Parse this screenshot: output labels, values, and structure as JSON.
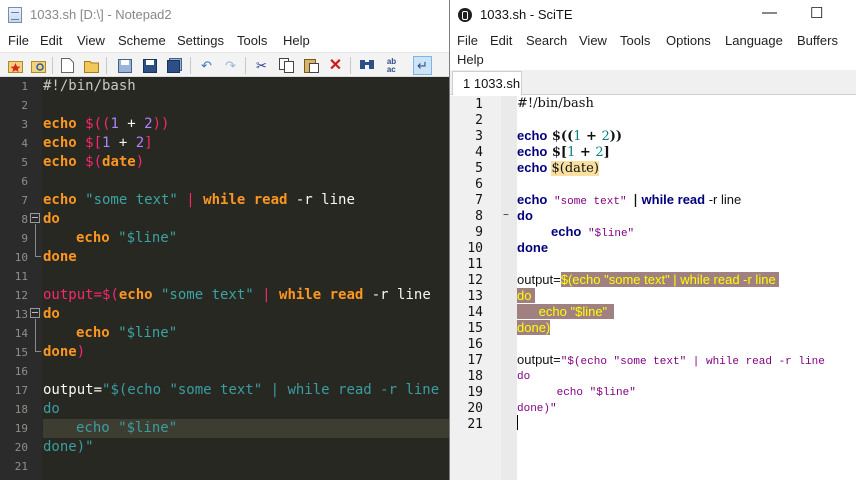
{
  "notepad2": {
    "title": "1033.sh [D:\\] - Notepad2",
    "menu": [
      "File",
      "Edit",
      "View",
      "Scheme",
      "Settings",
      "Tools",
      "Help"
    ],
    "line_numbers": [
      "1",
      "2",
      "3",
      "4",
      "5",
      "6",
      "7",
      "8",
      "9",
      "10",
      "11",
      "12",
      "13",
      "14",
      "15",
      "16",
      "17",
      "18",
      "19",
      "20",
      "21"
    ],
    "lines": {
      "l1": "#!/bin/bash",
      "l3": {
        "kw": "echo",
        "rest_a": " $((",
        "num1": "1",
        "op": " + ",
        "num2": "2",
        "rest_b": "))"
      },
      "l4": {
        "kw": "echo",
        "rest_a": " $[",
        "num1": "1",
        "op": " + ",
        "num2": "2",
        "rest_b": "]"
      },
      "l5": {
        "kw": "echo",
        "rest_a": " $(",
        "cmd": "date",
        "rest_b": ")"
      },
      "l7": {
        "kw": "echo",
        "str": " \"some text\" ",
        "pipe": "|",
        "kw2": " while read",
        "rest": " -r line"
      },
      "l8": "do",
      "l9": {
        "kw": "echo",
        "str": " \"$line\""
      },
      "l10": "done",
      "l12": {
        "pre": "output=$(",
        "kw": "echo",
        "str": " \"some text\" ",
        "pipe": "|",
        "kw2": " while read",
        "rest": " -r line"
      },
      "l13": "do",
      "l14": {
        "kw": "echo",
        "str": " \"$line\""
      },
      "l15": {
        "kw": "done",
        "rest": ")"
      },
      "l17": {
        "pre": "output=",
        "str": "\"$(echo \"some text\" | while read -r line"
      },
      "l18": "do",
      "l19": "echo \"$line\"",
      "l20": "done)\""
    }
  },
  "scite": {
    "title": "1033.sh - SciTE",
    "minimize": "—",
    "maximize": "☐",
    "menu_row1": [
      "File",
      "Edit",
      "Search",
      "View",
      "Tools",
      "Options",
      "Language",
      "Buffers"
    ],
    "menu_row2": [
      "Help"
    ],
    "tab_label": "1 1033.sh",
    "line_numbers": [
      "1",
      "2",
      "3",
      "4",
      "5",
      "6",
      "7",
      "8",
      "9",
      "10",
      "11",
      "12",
      "13",
      "14",
      "15",
      "16",
      "17",
      "18",
      "19",
      "20",
      "21"
    ],
    "lines": {
      "l1": "#!/bin/bash",
      "l3": {
        "kw": "echo",
        "pre": " $((",
        "num1": "1",
        "op": " + ",
        "num2": "2",
        "post": "))"
      },
      "l4": {
        "kw": "echo",
        "pre": " $[",
        "num1": "1",
        "op": " + ",
        "num2": "2",
        "post": "]"
      },
      "l5": {
        "kw": "echo",
        "sub": "$(date)"
      },
      "l7": {
        "kw": "echo",
        "str": " \"some text\" ",
        "pipe": "|",
        "kw2": " while read",
        "rest": " -r line"
      },
      "l8": "do",
      "l9": {
        "kw": "echo",
        "str": " \"$line\""
      },
      "l10": "done",
      "l12": {
        "pre": "output=",
        "bt": "$(echo \"some text\" | while read -r line "
      },
      "l13": "do ",
      "l14": "      echo \"$line\"  ",
      "l15": "done)",
      "l17": {
        "pre": "output=",
        "str": "\"$(echo \"some text\" | while read -r line"
      },
      "l18": "do",
      "l19": "      echo \"$line\"",
      "l20": "done)\""
    }
  },
  "colors": {
    "notepad2_bg": "#272822",
    "notepad2_keyword": "#fd971f",
    "notepad2_string": "#3ba3a3",
    "notepad2_number": "#ae81ff",
    "scite_keyword": "#00007f",
    "scite_string": "#7f007f",
    "scite_backtick_bg": "#a08080"
  },
  "icons": [
    "new-icon",
    "open-icon",
    "browse-icon",
    "save-icon",
    "save-as-icon",
    "save-copy-icon",
    "undo-icon",
    "redo-icon",
    "cut-icon",
    "copy-icon",
    "paste-icon",
    "delete-icon",
    "find-icon",
    "replace-icon",
    "word-wrap-icon"
  ]
}
